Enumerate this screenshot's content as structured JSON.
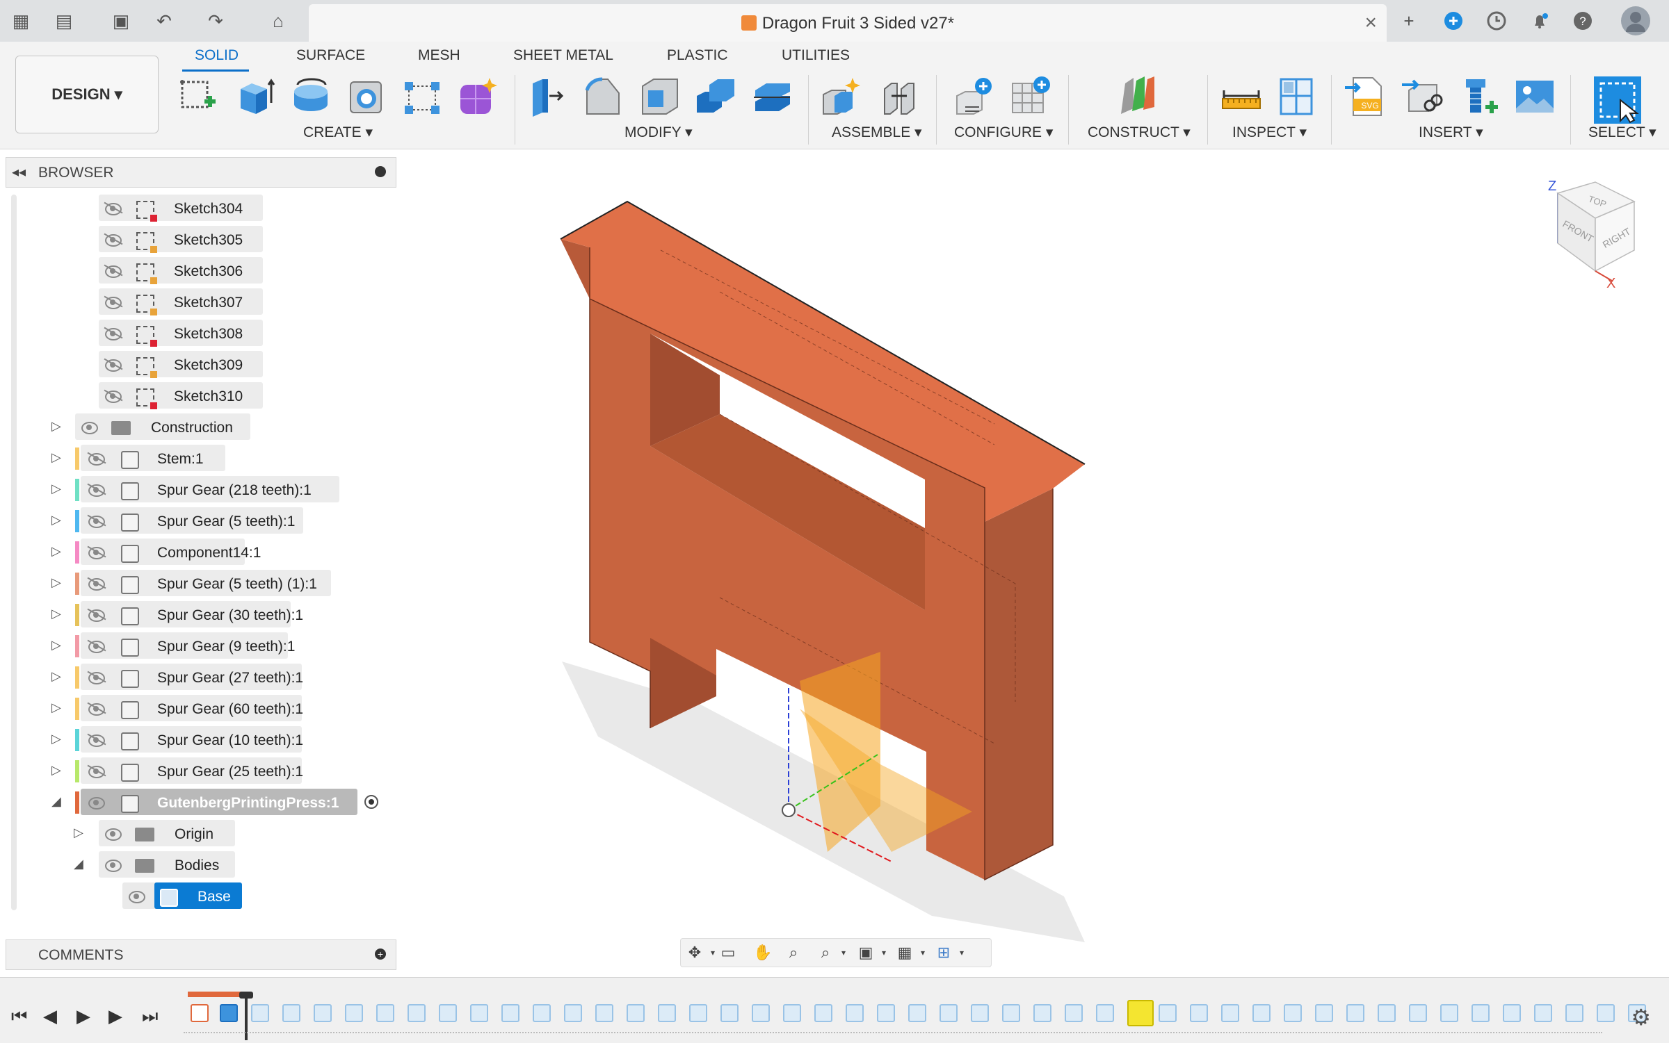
{
  "titlebar": {
    "document_title": "Dragon Fruit 3 Sided v27*",
    "close_glyph": "×",
    "icons": [
      "apps-grid-icon",
      "file-icon",
      "save-icon",
      "undo-icon",
      "redo-icon",
      "home-icon",
      "new-tab-icon",
      "extensions-icon",
      "job-status-icon",
      "notifications-icon",
      "help-icon",
      "user-avatar"
    ]
  },
  "toolbar": {
    "workspace_button": "DESIGN",
    "tabs": [
      "SOLID",
      "SURFACE",
      "MESH",
      "SHEET METAL",
      "PLASTIC",
      "UTILITIES"
    ],
    "active_tab": "SOLID",
    "groups": [
      "CREATE",
      "MODIFY",
      "ASSEMBLE",
      "CONFIGURE",
      "CONSTRUCT",
      "INSPECT",
      "INSERT",
      "SELECT"
    ],
    "accent": "#0b6fc9"
  },
  "browser": {
    "title": "BROWSER",
    "sketches": [
      "Sketch304",
      "Sketch305",
      "Sketch306",
      "Sketch307",
      "Sketch308",
      "Sketch309",
      "Sketch310"
    ],
    "construction": "Construction",
    "components": [
      {
        "label": "Stem:1",
        "color": "#f7c96a"
      },
      {
        "label": "Spur Gear (218 teeth):1",
        "color": "#6fe0c4"
      },
      {
        "label": "Spur Gear (5 teeth):1",
        "color": "#4fb8f0"
      },
      {
        "label": "Component14:1",
        "color": "#f58ac4"
      },
      {
        "label": "Spur Gear (5 teeth) (1):1",
        "color": "#e89a7a"
      },
      {
        "label": "Spur Gear (30 teeth):1",
        "color": "#e6c25a"
      },
      {
        "label": "Spur Gear (9 teeth):1",
        "color": "#f29aa6"
      },
      {
        "label": "Spur Gear (27 teeth):1",
        "color": "#f7c96a"
      },
      {
        "label": "Spur Gear (60 teeth):1",
        "color": "#f7c96a"
      },
      {
        "label": "Spur Gear (10 teeth):1",
        "color": "#5ad4d8"
      },
      {
        "label": "Spur Gear (25 teeth):1",
        "color": "#b7e86a"
      }
    ],
    "active_component": "GutenbergPrintingPress:1",
    "origin": "Origin",
    "bodies": "Bodies",
    "base_body": "Base"
  },
  "comments": {
    "title": "COMMENTS"
  },
  "viewcube": {
    "top": "TOP",
    "front": "FRONT",
    "right": "RIGHT",
    "z": "Z",
    "x": "X"
  },
  "model": {
    "body_color": "#c8643f",
    "top_color": "#e07048"
  }
}
